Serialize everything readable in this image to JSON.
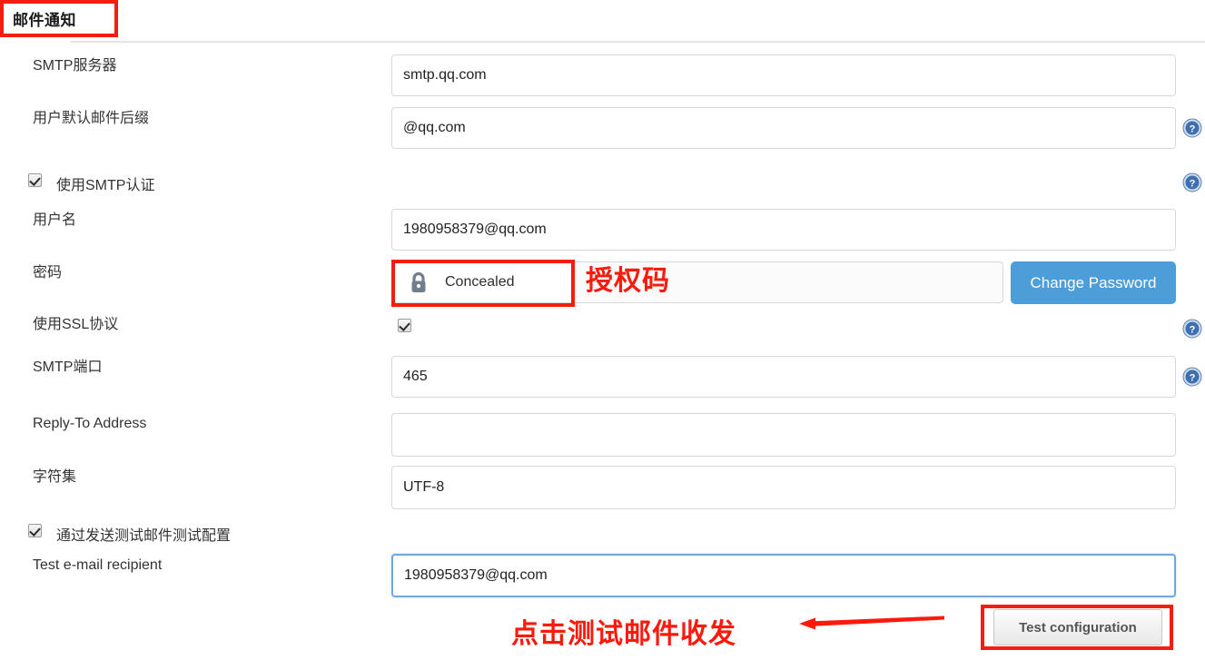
{
  "section": {
    "title": "邮件通知"
  },
  "fields": {
    "smtp_server": {
      "label": "SMTP服务器",
      "value": "smtp.qq.com",
      "placeholder": ""
    },
    "mail_suffix": {
      "label": "用户默认邮件后缀",
      "value": "@qq.com",
      "placeholder": ""
    },
    "use_smtp_auth": {
      "label": "使用SMTP认证",
      "checked": true
    },
    "username": {
      "label": "用户名",
      "value": "1980958379@qq.com",
      "placeholder": ""
    },
    "password": {
      "label": "密码",
      "value": "Concealed",
      "icon": "lock-icon",
      "change_button": "Change Password"
    },
    "use_ssl": {
      "label": "使用SSL协议",
      "checked": true
    },
    "smtp_port": {
      "label": "SMTP端口",
      "value": "465",
      "placeholder": ""
    },
    "reply_to": {
      "label": "Reply-To Address",
      "value": "",
      "placeholder": ""
    },
    "charset": {
      "label": "字符集",
      "value": "UTF-8",
      "placeholder": ""
    },
    "test_config_check": {
      "label": "通过发送测试邮件测试配置",
      "checked": true
    },
    "test_recipient": {
      "label": "Test e-mail recipient",
      "value": "1980958379@qq.com",
      "placeholder": ""
    }
  },
  "buttons": {
    "test_configuration": "Test configuration"
  },
  "annotations": {
    "password_note": "授权码",
    "test_note": "点击测试邮件收发"
  },
  "icons": {
    "help": "?"
  },
  "colors": {
    "annotation_red": "#f41e10",
    "primary_blue": "#4d9dd8",
    "focus_blue": "#6ea8e0",
    "lock_gray": "#6f7f8d"
  }
}
